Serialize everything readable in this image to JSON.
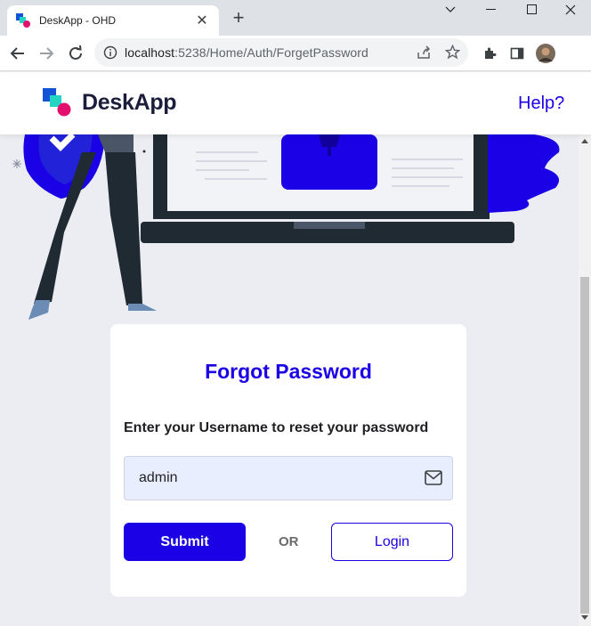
{
  "browser": {
    "tab_title": "DeskApp - OHD",
    "url_host": "localhost",
    "url_rest": ":5238/Home/Auth/ForgetPassword"
  },
  "header": {
    "brand": "DeskApp",
    "help": "Help?"
  },
  "form": {
    "title": "Forgot Password",
    "subtitle": "Enter your Username to reset your password",
    "username_value": "admin",
    "submit_label": "Submit",
    "or_label": "OR",
    "login_label": "Login"
  },
  "colors": {
    "accent": "#1a01e6",
    "background": "#ecedf2",
    "text": "#202124"
  }
}
